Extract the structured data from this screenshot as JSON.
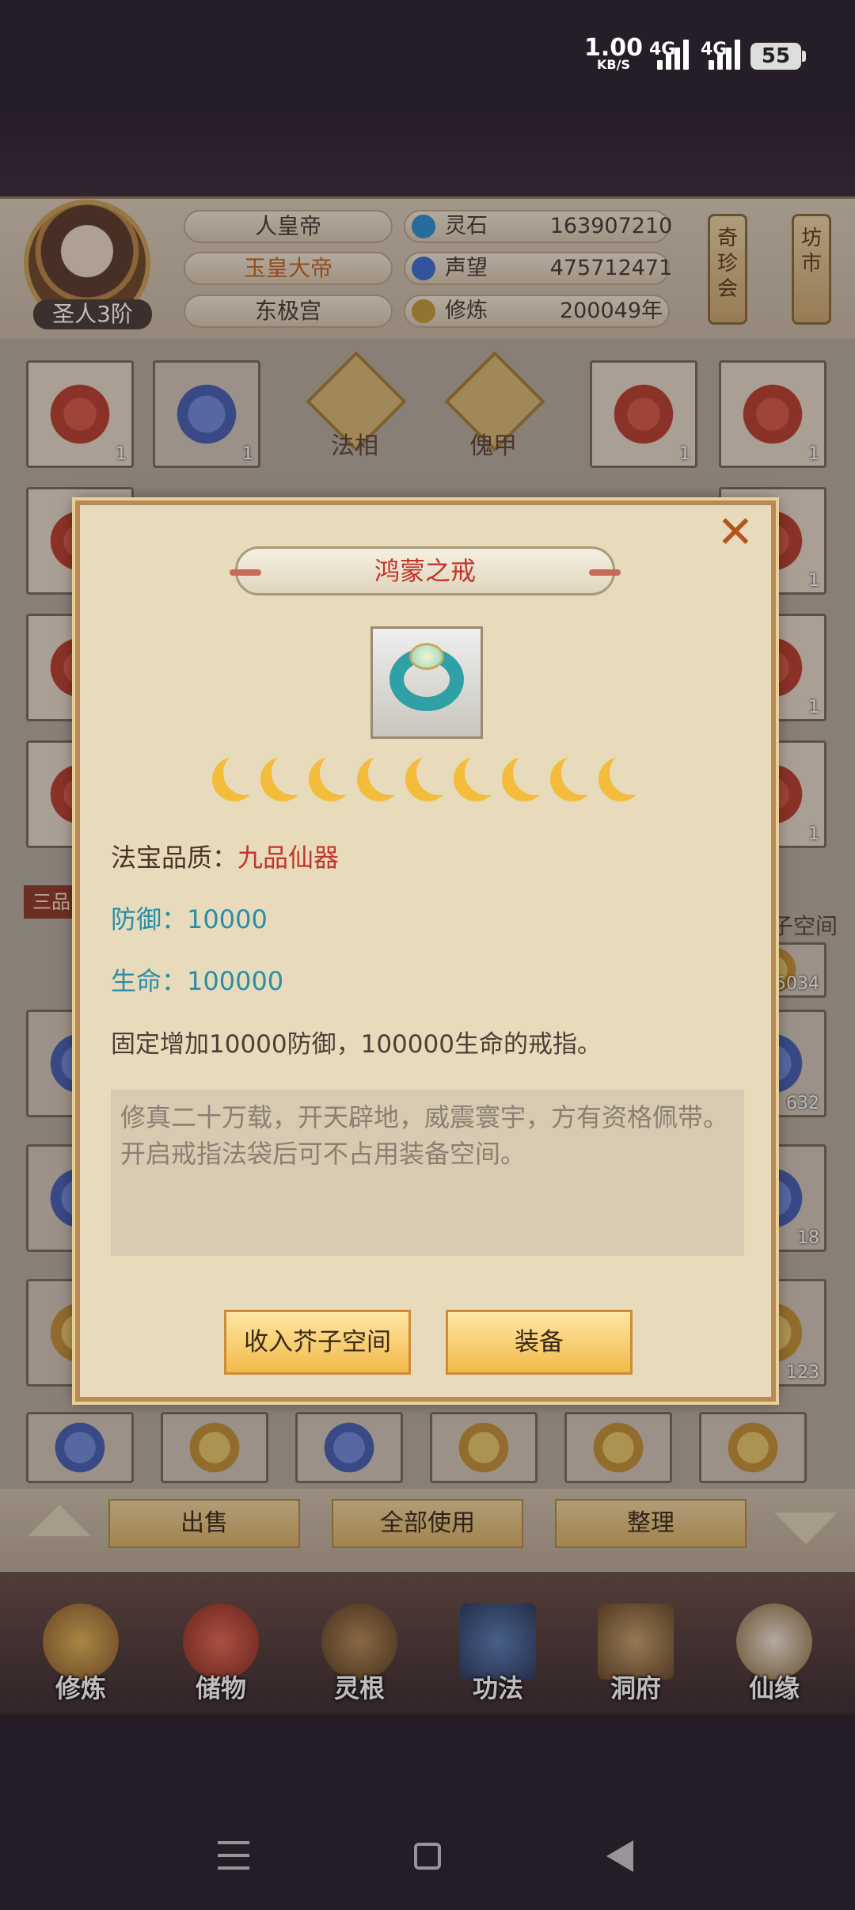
{
  "status_bar": {
    "speed_value": "1.00",
    "speed_unit": "KB/S",
    "net1": "4G",
    "net2": "4G",
    "battery": "55"
  },
  "player": {
    "rank": "圣人3阶",
    "titles": [
      "人皇帝",
      "玉皇大帝",
      "东极宫"
    ],
    "stats": [
      {
        "label": "灵石",
        "value": "163907210",
        "icon": "spirit-stone-icon",
        "color": "#2c8fcf"
      },
      {
        "label": "声望",
        "value": "475712471",
        "icon": "reputation-icon",
        "color": "#3f6fd0"
      },
      {
        "label": "修炼",
        "value": "200049年",
        "icon": "cultivation-icon",
        "color": "#c39a3a"
      }
    ],
    "scroll_buttons": [
      "奇珍会",
      "坊市"
    ]
  },
  "inventory": {
    "equip_tabs": [
      "法相",
      "傀甲"
    ],
    "side_labels": {
      "category": "三品",
      "space": "芥子空间"
    },
    "counts": [
      "1",
      "1",
      "1",
      "1",
      "1",
      "1",
      "1",
      "1",
      "5034",
      "632",
      "18",
      "123"
    ]
  },
  "action_bar": {
    "sell": "出售",
    "use_all": "全部使用",
    "organize": "整理"
  },
  "bottom_nav": [
    {
      "label": "修炼",
      "icon": "cultivate-nav-icon"
    },
    {
      "label": "储物",
      "icon": "storage-bag-icon"
    },
    {
      "label": "灵根",
      "icon": "spirit-root-icon"
    },
    {
      "label": "功法",
      "icon": "technique-book-icon"
    },
    {
      "label": "洞府",
      "icon": "cave-house-icon"
    },
    {
      "label": "仙缘",
      "icon": "immortal-fate-icon"
    }
  ],
  "dialog": {
    "title": "鸿蒙之戒",
    "star_count": 9,
    "quality_label": "法宝品质：",
    "quality_value": "九品仙器",
    "defense": "防御：10000",
    "life": "生命：100000",
    "effect": "固定增加10000防御，100000生命的戒指。",
    "lore": "修真二十万载，开天辟地，威震寰宇，方有资格佩带。开启戒指法袋后可不占用装备空间。",
    "store_button": "收入芥子空间",
    "equip_button": "装备"
  }
}
